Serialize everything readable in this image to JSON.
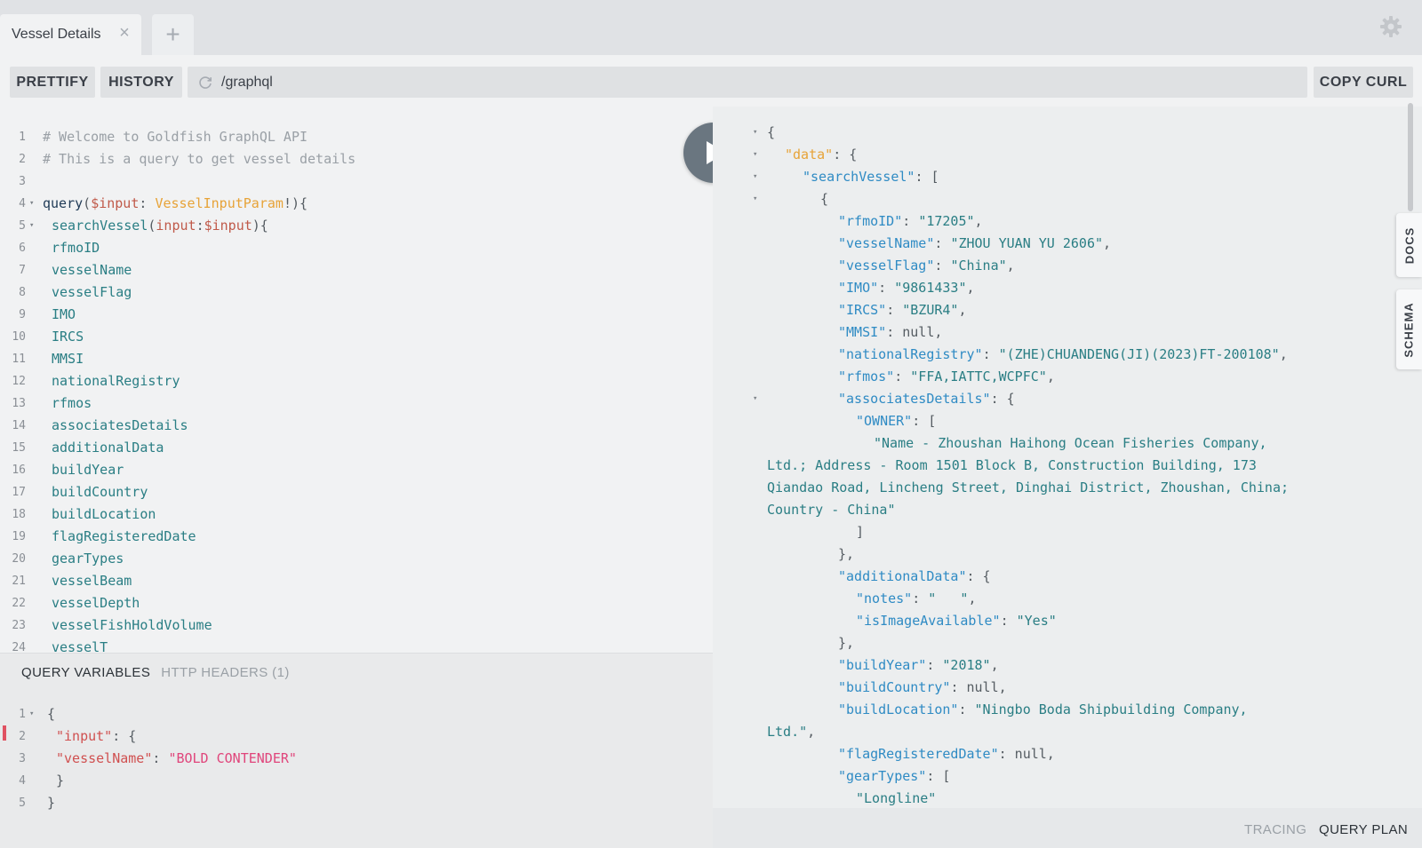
{
  "tabs": [
    {
      "label": "Vessel Details",
      "close_glyph": "×"
    }
  ],
  "new_tab_glyph": "+",
  "toolbar": {
    "prettify_label": "PRETTIFY",
    "history_label": "HISTORY",
    "url": "/graphql",
    "copy_curl_label": "COPY CURL"
  },
  "icons": {
    "settings": "gear-icon",
    "reload": "reload-icon",
    "run": "play-icon"
  },
  "query_lines": [
    {
      "n": "1",
      "parts": [
        {
          "t": "# Welcome to Goldfish GraphQL API",
          "c": "c-comment"
        }
      ]
    },
    {
      "n": "2",
      "parts": [
        {
          "t": "# This is a query to get vessel details",
          "c": "c-comment"
        }
      ]
    },
    {
      "n": "3",
      "parts": []
    },
    {
      "n": "4",
      "fold": true,
      "parts": [
        {
          "t": "query",
          "c": "c-kw"
        },
        {
          "t": "(",
          "c": "c-punct"
        },
        {
          "t": "$input",
          "c": "c-var"
        },
        {
          "t": ": ",
          "c": "c-punct"
        },
        {
          "t": "VesselInputParam",
          "c": "c-type"
        },
        {
          "t": "!){",
          "c": "c-punct"
        }
      ]
    },
    {
      "n": "5",
      "fold": true,
      "indent": 1,
      "parts": [
        {
          "t": "searchVessel",
          "c": "c-field"
        },
        {
          "t": "(",
          "c": "c-punct"
        },
        {
          "t": "input",
          "c": "c-arg"
        },
        {
          "t": ":",
          "c": "c-punct"
        },
        {
          "t": "$input",
          "c": "c-var"
        },
        {
          "t": "){",
          "c": "c-punct"
        }
      ]
    },
    {
      "n": "6",
      "indent": 1,
      "parts": [
        {
          "t": "rfmoID",
          "c": "c-field"
        }
      ]
    },
    {
      "n": "7",
      "indent": 1,
      "parts": [
        {
          "t": "vesselName",
          "c": "c-field"
        }
      ]
    },
    {
      "n": "8",
      "indent": 1,
      "parts": [
        {
          "t": "vesselFlag",
          "c": "c-field"
        }
      ]
    },
    {
      "n": "9",
      "indent": 1,
      "parts": [
        {
          "t": "IMO",
          "c": "c-field"
        }
      ]
    },
    {
      "n": "10",
      "indent": 1,
      "parts": [
        {
          "t": "IRCS",
          "c": "c-field"
        }
      ]
    },
    {
      "n": "11",
      "indent": 1,
      "parts": [
        {
          "t": "MMSI",
          "c": "c-field"
        }
      ]
    },
    {
      "n": "12",
      "indent": 1,
      "parts": [
        {
          "t": "nationalRegistry",
          "c": "c-field"
        }
      ]
    },
    {
      "n": "13",
      "indent": 1,
      "parts": [
        {
          "t": "rfmos",
          "c": "c-field"
        }
      ]
    },
    {
      "n": "14",
      "indent": 1,
      "parts": [
        {
          "t": "associatesDetails",
          "c": "c-field"
        }
      ]
    },
    {
      "n": "15",
      "indent": 1,
      "parts": [
        {
          "t": "additionalData",
          "c": "c-field"
        }
      ]
    },
    {
      "n": "16",
      "indent": 1,
      "parts": [
        {
          "t": "buildYear",
          "c": "c-field"
        }
      ]
    },
    {
      "n": "17",
      "indent": 1,
      "parts": [
        {
          "t": "buildCountry",
          "c": "c-field"
        }
      ]
    },
    {
      "n": "18",
      "indent": 1,
      "parts": [
        {
          "t": "buildLocation",
          "c": "c-field"
        }
      ]
    },
    {
      "n": "19",
      "indent": 1,
      "parts": [
        {
          "t": "flagRegisteredDate",
          "c": "c-field"
        }
      ]
    },
    {
      "n": "20",
      "indent": 1,
      "parts": [
        {
          "t": "gearTypes",
          "c": "c-field"
        }
      ]
    },
    {
      "n": "21",
      "indent": 1,
      "parts": [
        {
          "t": "vesselBeam",
          "c": "c-field"
        }
      ]
    },
    {
      "n": "22",
      "indent": 1,
      "parts": [
        {
          "t": "vesselDepth",
          "c": "c-field"
        }
      ]
    },
    {
      "n": "23",
      "indent": 1,
      "parts": [
        {
          "t": "vesselFishHoldVolume",
          "c": "c-field"
        }
      ]
    },
    {
      "n": "24",
      "indent": 1,
      "parts": [
        {
          "t": "vesselT",
          "c": "c-field"
        }
      ]
    }
  ],
  "variables_pane": {
    "tab_query_variables": "QUERY VARIABLES",
    "tab_http_headers": "HTTP HEADERS (1)",
    "lines": [
      {
        "n": "1",
        "fold": true,
        "parts": [
          {
            "t": "{",
            "c": "c-punct"
          }
        ]
      },
      {
        "n": "2",
        "indent": 1,
        "parts": [
          {
            "t": "\"input\"",
            "c": "v-key"
          },
          {
            "t": ": {",
            "c": "c-punct"
          }
        ]
      },
      {
        "n": "3",
        "indent": 1,
        "parts": [
          {
            "t": "\"vesselName\"",
            "c": "v-key"
          },
          {
            "t": ": ",
            "c": "c-punct"
          },
          {
            "t": "\"BOLD CONTENDER\"",
            "c": "v-str"
          }
        ]
      },
      {
        "n": "4",
        "indent": 1,
        "parts": [
          {
            "t": "}",
            "c": "c-punct"
          }
        ]
      },
      {
        "n": "5",
        "parts": [
          {
            "t": "}",
            "c": "c-punct"
          }
        ]
      }
    ]
  },
  "result_lines": [
    {
      "fold": true,
      "indent": 0,
      "parts": [
        {
          "t": "{",
          "c": "r-punct"
        }
      ]
    },
    {
      "fold": true,
      "indent": 1,
      "parts": [
        {
          "t": "\"data\"",
          "c": "r-key-top"
        },
        {
          "t": ": {",
          "c": "r-punct"
        }
      ]
    },
    {
      "fold": true,
      "indent": 2,
      "parts": [
        {
          "t": "\"searchVessel\"",
          "c": "r-key"
        },
        {
          "t": ": [",
          "c": "r-punct"
        }
      ]
    },
    {
      "fold": true,
      "indent": 3,
      "parts": [
        {
          "t": "{",
          "c": "r-punct"
        }
      ]
    },
    {
      "indent": 4,
      "parts": [
        {
          "t": "\"rfmoID\"",
          "c": "r-key"
        },
        {
          "t": ": ",
          "c": "r-punct"
        },
        {
          "t": "\"17205\"",
          "c": "r-str"
        },
        {
          "t": ",",
          "c": "r-punct"
        }
      ]
    },
    {
      "indent": 4,
      "parts": [
        {
          "t": "\"vesselName\"",
          "c": "r-key"
        },
        {
          "t": ": ",
          "c": "r-punct"
        },
        {
          "t": "\"ZHOU YUAN YU 2606\"",
          "c": "r-str"
        },
        {
          "t": ",",
          "c": "r-punct"
        }
      ]
    },
    {
      "indent": 4,
      "parts": [
        {
          "t": "\"vesselFlag\"",
          "c": "r-key"
        },
        {
          "t": ": ",
          "c": "r-punct"
        },
        {
          "t": "\"China\"",
          "c": "r-str"
        },
        {
          "t": ",",
          "c": "r-punct"
        }
      ]
    },
    {
      "indent": 4,
      "parts": [
        {
          "t": "\"IMO\"",
          "c": "r-key"
        },
        {
          "t": ": ",
          "c": "r-punct"
        },
        {
          "t": "\"9861433\"",
          "c": "r-str"
        },
        {
          "t": ",",
          "c": "r-punct"
        }
      ]
    },
    {
      "indent": 4,
      "parts": [
        {
          "t": "\"IRCS\"",
          "c": "r-key"
        },
        {
          "t": ": ",
          "c": "r-punct"
        },
        {
          "t": "\"BZUR4\"",
          "c": "r-str"
        },
        {
          "t": ",",
          "c": "r-punct"
        }
      ]
    },
    {
      "indent": 4,
      "parts": [
        {
          "t": "\"MMSI\"",
          "c": "r-key"
        },
        {
          "t": ": null,",
          "c": "r-punct"
        }
      ]
    },
    {
      "indent": 4,
      "parts": [
        {
          "t": "\"nationalRegistry\"",
          "c": "r-key"
        },
        {
          "t": ": ",
          "c": "r-punct"
        },
        {
          "t": "\"(ZHE)CHUANDENG(JI)(2023)FT-200108\"",
          "c": "r-str"
        },
        {
          "t": ",",
          "c": "r-punct"
        }
      ]
    },
    {
      "indent": 4,
      "parts": [
        {
          "t": "\"rfmos\"",
          "c": "r-key"
        },
        {
          "t": ": ",
          "c": "r-punct"
        },
        {
          "t": "\"FFA,IATTC,WCPFC\"",
          "c": "r-str"
        },
        {
          "t": ",",
          "c": "r-punct"
        }
      ]
    },
    {
      "fold": true,
      "indent": 4,
      "parts": [
        {
          "t": "\"associatesDetails\"",
          "c": "r-key"
        },
        {
          "t": ": {",
          "c": "r-punct"
        }
      ]
    },
    {
      "indent": 5,
      "parts": [
        {
          "t": "\"OWNER\"",
          "c": "r-key"
        },
        {
          "t": ": [",
          "c": "r-punct"
        }
      ]
    },
    {
      "indent": 6,
      "parts": [
        {
          "t": "\"Name - Zhoushan Haihong Ocean Fisheries Company,",
          "c": "r-str"
        }
      ]
    },
    {
      "indent": 0,
      "parts": [
        {
          "t": "Ltd.; Address - Room 1501 Block B, Construction Building, 173",
          "c": "r-str"
        }
      ]
    },
    {
      "indent": 0,
      "parts": [
        {
          "t": "Qiandao Road, Lincheng Street, Dinghai District, Zhoushan, China;",
          "c": "r-str"
        }
      ]
    },
    {
      "indent": 0,
      "parts": [
        {
          "t": "Country - China\"",
          "c": "r-str"
        }
      ]
    },
    {
      "indent": 5,
      "parts": [
        {
          "t": "]",
          "c": "r-punct"
        }
      ]
    },
    {
      "indent": 4,
      "parts": [
        {
          "t": "},",
          "c": "r-punct"
        }
      ]
    },
    {
      "indent": 4,
      "parts": [
        {
          "t": "\"additionalData\"",
          "c": "r-key"
        },
        {
          "t": ": {",
          "c": "r-punct"
        }
      ]
    },
    {
      "indent": 5,
      "parts": [
        {
          "t": "\"notes\"",
          "c": "r-key"
        },
        {
          "t": ": ",
          "c": "r-punct"
        },
        {
          "t": "\"   \"",
          "c": "r-str"
        },
        {
          "t": ",",
          "c": "r-punct"
        }
      ]
    },
    {
      "indent": 5,
      "parts": [
        {
          "t": "\"isImageAvailable\"",
          "c": "r-key"
        },
        {
          "t": ": ",
          "c": "r-punct"
        },
        {
          "t": "\"Yes\"",
          "c": "r-str"
        }
      ]
    },
    {
      "indent": 4,
      "parts": [
        {
          "t": "},",
          "c": "r-punct"
        }
      ]
    },
    {
      "indent": 4,
      "parts": [
        {
          "t": "\"buildYear\"",
          "c": "r-key"
        },
        {
          "t": ": ",
          "c": "r-punct"
        },
        {
          "t": "\"2018\"",
          "c": "r-str"
        },
        {
          "t": ",",
          "c": "r-punct"
        }
      ]
    },
    {
      "indent": 4,
      "parts": [
        {
          "t": "\"buildCountry\"",
          "c": "r-key"
        },
        {
          "t": ": null,",
          "c": "r-punct"
        }
      ]
    },
    {
      "indent": 4,
      "parts": [
        {
          "t": "\"buildLocation\"",
          "c": "r-key"
        },
        {
          "t": ": ",
          "c": "r-punct"
        },
        {
          "t": "\"Ningbo Boda Shipbuilding Company,",
          "c": "r-str"
        }
      ]
    },
    {
      "indent": 0,
      "parts": [
        {
          "t": "Ltd.\"",
          "c": "r-str"
        },
        {
          "t": ",",
          "c": "r-punct"
        }
      ]
    },
    {
      "indent": 4,
      "parts": [
        {
          "t": "\"flagRegisteredDate\"",
          "c": "r-key"
        },
        {
          "t": ": null,",
          "c": "r-punct"
        }
      ]
    },
    {
      "indent": 4,
      "parts": [
        {
          "t": "\"gearTypes\"",
          "c": "r-key"
        },
        {
          "t": ": [",
          "c": "r-punct"
        }
      ]
    },
    {
      "indent": 5,
      "parts": [
        {
          "t": "\"Longline\"",
          "c": "r-str"
        }
      ]
    }
  ],
  "side_tabs": {
    "docs": "DOCS",
    "schema": "SCHEMA"
  },
  "footer": {
    "tracing": "TRACING",
    "query_plan": "QUERY PLAN"
  },
  "colors": {
    "accent_orange": "#e7a338",
    "field_teal": "#2a7e84",
    "json_key_blue": "#2f8bc4",
    "var_key_red": "#d05050",
    "var_string_pink": "#e0457b",
    "error_marker": "#e05262",
    "run_button": "#6a7680"
  }
}
